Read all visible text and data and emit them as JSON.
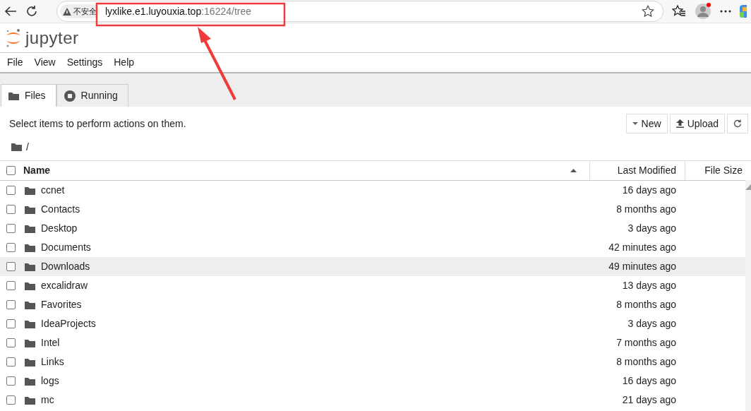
{
  "browser": {
    "security_label": "不安全",
    "url_host": "lyxlike.e1.luyouxia.top",
    "url_path": ":16224/tree"
  },
  "app": {
    "logo_text": "jupyter"
  },
  "menu": [
    "File",
    "View",
    "Settings",
    "Help"
  ],
  "tabs": [
    {
      "label": "Files",
      "selected": true,
      "kind": "folder"
    },
    {
      "label": "Running",
      "selected": false,
      "kind": "running"
    }
  ],
  "toolbar": {
    "hint": "Select items to perform actions on them.",
    "buttons": [
      {
        "kind": "dropdown",
        "label": "New"
      },
      {
        "kind": "upload",
        "label": "Upload"
      },
      {
        "kind": "refresh"
      }
    ]
  },
  "breadcrumb": "/",
  "table": {
    "select_all_checked": false,
    "columns": [
      {
        "label": "Name",
        "sorted": true
      },
      {
        "label": "Last Modified",
        "sorted": false
      },
      {
        "label": "File Size",
        "sorted": false
      }
    ],
    "rows": [
      {
        "name": "ccnet",
        "modified": "16 days ago",
        "checked": false,
        "highlighted": false
      },
      {
        "name": "Contacts",
        "modified": "8 months ago",
        "checked": false,
        "highlighted": false
      },
      {
        "name": "Desktop",
        "modified": "3 days ago",
        "checked": false,
        "highlighted": false
      },
      {
        "name": "Documents",
        "modified": "42 minutes ago",
        "checked": false,
        "highlighted": false
      },
      {
        "name": "Downloads",
        "modified": "49 minutes ago",
        "checked": false,
        "highlighted": true
      },
      {
        "name": "excalidraw",
        "modified": "13 days ago",
        "checked": false,
        "highlighted": false
      },
      {
        "name": "Favorites",
        "modified": "8 months ago",
        "checked": false,
        "highlighted": false
      },
      {
        "name": "IdeaProjects",
        "modified": "3 days ago",
        "checked": false,
        "highlighted": false
      },
      {
        "name": "Intel",
        "modified": "7 months ago",
        "checked": false,
        "highlighted": false
      },
      {
        "name": "Links",
        "modified": "8 months ago",
        "checked": false,
        "highlighted": false
      },
      {
        "name": "logs",
        "modified": "16 days ago",
        "checked": false,
        "highlighted": false
      },
      {
        "name": "mc",
        "modified": "21 days ago",
        "checked": false,
        "highlighted": false
      }
    ]
  }
}
